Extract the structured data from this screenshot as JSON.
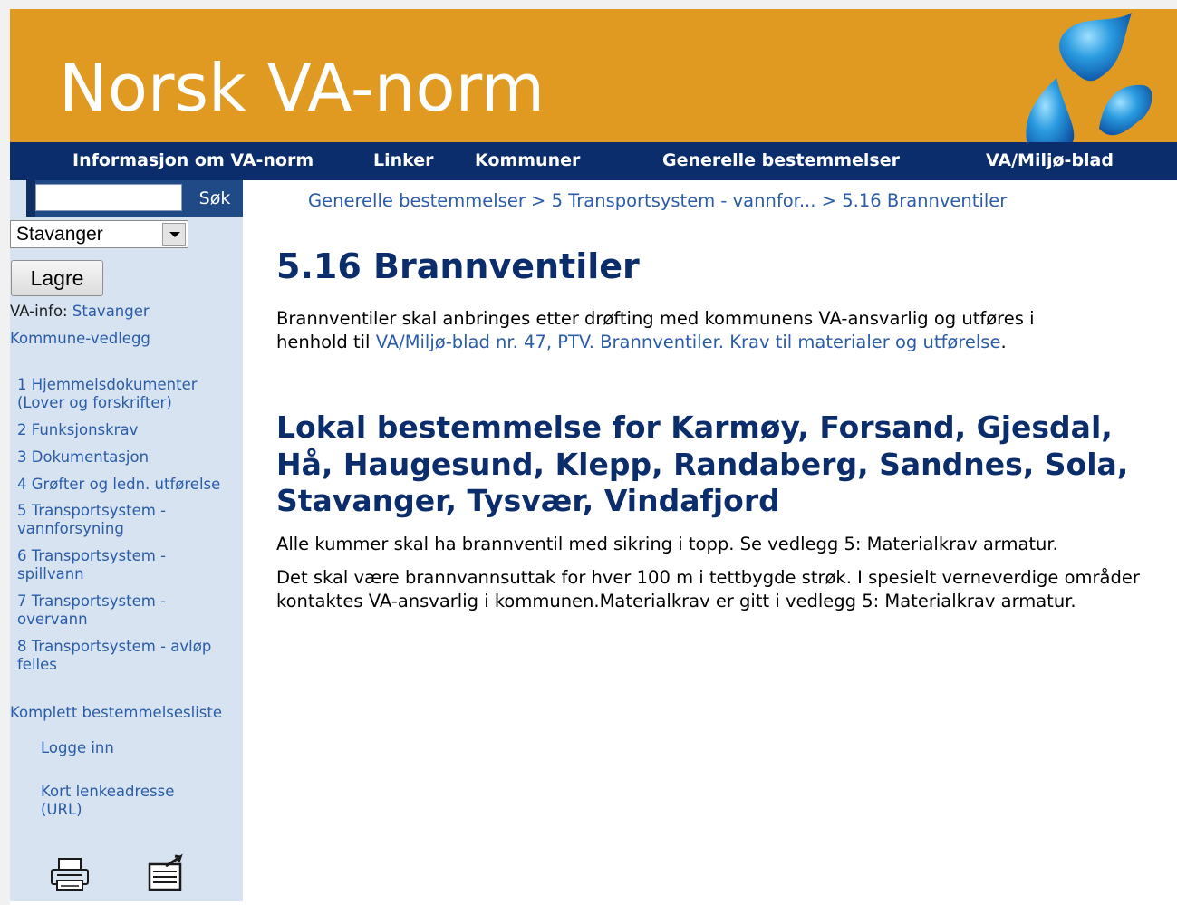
{
  "header": {
    "title": "Norsk VA-norm",
    "logo_icon": "water-drops-logo-icon"
  },
  "nav": {
    "items": [
      {
        "label": "Informasjon om VA-norm"
      },
      {
        "label": "Linker"
      },
      {
        "label": "Kommuner"
      },
      {
        "label": "Generelle bestemmelser"
      },
      {
        "label": "VA/Miljø-blad"
      }
    ]
  },
  "sidebar": {
    "search_button": "Søk",
    "search_value": "",
    "municipality_select": "Stavanger",
    "save_button": "Lagre",
    "va_info_label": "VA-info:",
    "va_info_link": "Stavanger",
    "attachments_link": "Kommune-vedlegg",
    "toc": [
      {
        "line1": "1 Hjemmelsdokumenter",
        "line2": "(Lover og forskrifter)"
      },
      {
        "line1": "2 Funksjonskrav",
        "line2": ""
      },
      {
        "line1": "3 Dokumentasjon",
        "line2": ""
      },
      {
        "line1": "4 Grøfter og ledn. utførelse",
        "line2": ""
      },
      {
        "line1": "5 Transportsystem -",
        "line2": "vannforsyning"
      },
      {
        "line1": "6 Transportsystem -",
        "line2": "spillvann"
      },
      {
        "line1": "7 Transportsystem -",
        "line2": "overvann"
      },
      {
        "line1": "8 Transportsystem - avløp",
        "line2": "felles"
      }
    ],
    "full_list_link": "Komplett bestemmelsesliste",
    "login_link": "Logge inn",
    "short_url_line1": "Kort lenkeadresse",
    "short_url_line2": "(URL)",
    "print_icon": "printer-icon",
    "export_icon": "document-export-icon"
  },
  "breadcrumb": {
    "item1": "Generelle bestemmelser",
    "item2": "5 Transportsystem - vannfor...",
    "item3": "5.16 Brannventiler",
    "separator": ">"
  },
  "content": {
    "title": "5.16 Brannventiler",
    "intro_text": "Brannventiler skal anbringes etter drøfting med kommunens VA-ansvarlig og utføres i",
    "intro_text2": "henhold til ",
    "intro_link": "VA/Miljø-blad nr. 47, PTV. Brannventiler. Krav til materialer og utførelse",
    "intro_end": ".",
    "local_heading": "Lokal bestemmelse for Karmøy, Forsand, Gjesdal, Hå, Haugesund, Klepp, Randaberg, Sandnes, Sola, Stavanger, Tysvær, Vindafjord",
    "local_para1": "Alle kummer skal ha brannventil med sikring i topp. Se vedlegg 5: Materialkrav armatur.",
    "local_para2": "Det skal være brannvannsuttak for hver 100 m i tettbygde strøk. I spesielt verneverdige områder kontaktes VA-ansvarlig i kommunen.Materialkrav er gitt i vedlegg 5: Materialkrav armatur."
  },
  "colors": {
    "banner": "#e09a22",
    "navbar": "#0b2d6b",
    "sidebar": "#d7e3f1",
    "heading": "#0b2d6b",
    "link": "#2a5ca8"
  }
}
